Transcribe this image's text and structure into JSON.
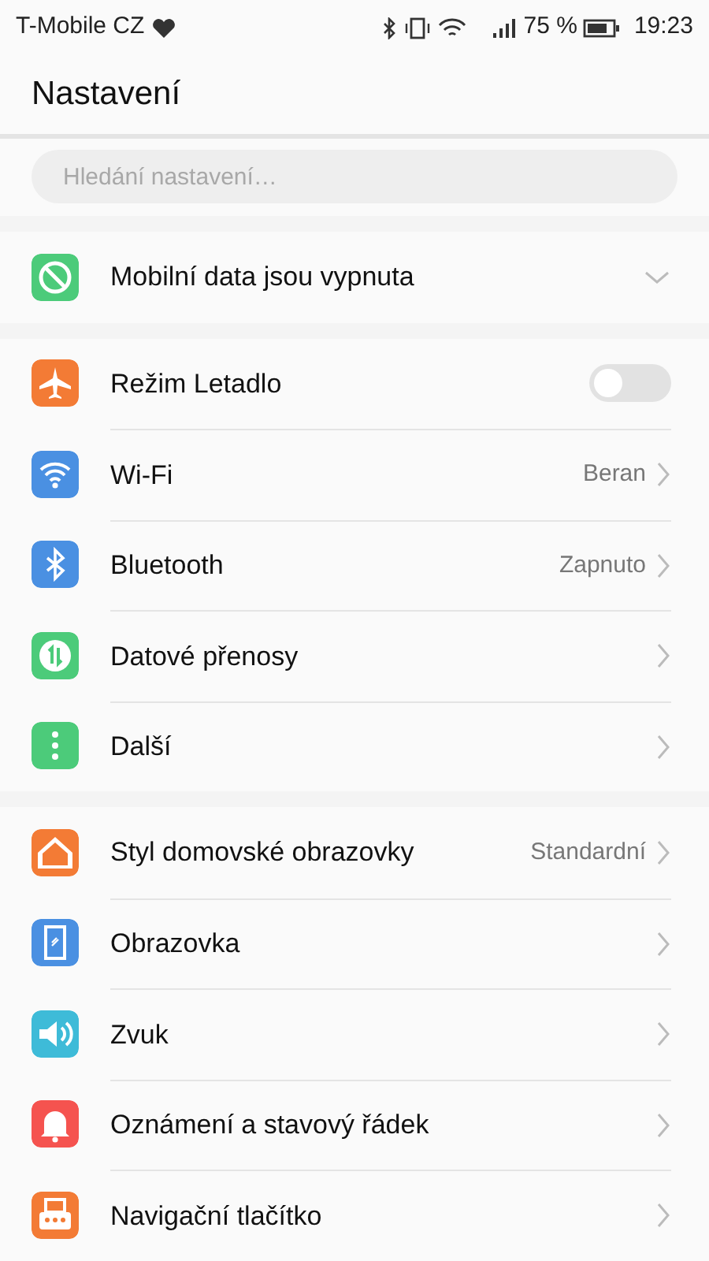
{
  "status_bar": {
    "carrier": "T-Mobile CZ",
    "battery": "75 %",
    "time": "19:23"
  },
  "title": "Nastavení",
  "search": {
    "placeholder": "Hledání nastavení…"
  },
  "sections": [
    [
      {
        "kind": "expand",
        "color": "#4ccb7a",
        "label": "Mobilní data jsou vypnuta"
      }
    ],
    [
      {
        "kind": "toggle",
        "color": "#f37b35",
        "label": "Režim Letadlo",
        "on": false
      },
      {
        "kind": "link",
        "color": "#4a90e2",
        "label": "Wi-Fi",
        "value": "Beran"
      },
      {
        "kind": "link",
        "color": "#4a90e2",
        "label": "Bluetooth",
        "value": "Zapnuto"
      },
      {
        "kind": "link",
        "color": "#4ccb7a",
        "label": "Datové přenosy"
      },
      {
        "kind": "link",
        "color": "#4ccb7a",
        "label": "Další"
      }
    ],
    [
      {
        "kind": "link",
        "color": "#f37b35",
        "label": "Styl domovské obrazovky",
        "value": "Standardní"
      },
      {
        "kind": "link",
        "color": "#4a90e2",
        "label": "Obrazovka"
      },
      {
        "kind": "link",
        "color": "#3ebbd8",
        "label": "Zvuk"
      },
      {
        "kind": "link",
        "color": "#f5534f",
        "label": "Oznámení a stavový řádek"
      },
      {
        "kind": "link",
        "color": "#f37b35",
        "label": "Navigační tlačítko"
      }
    ]
  ]
}
